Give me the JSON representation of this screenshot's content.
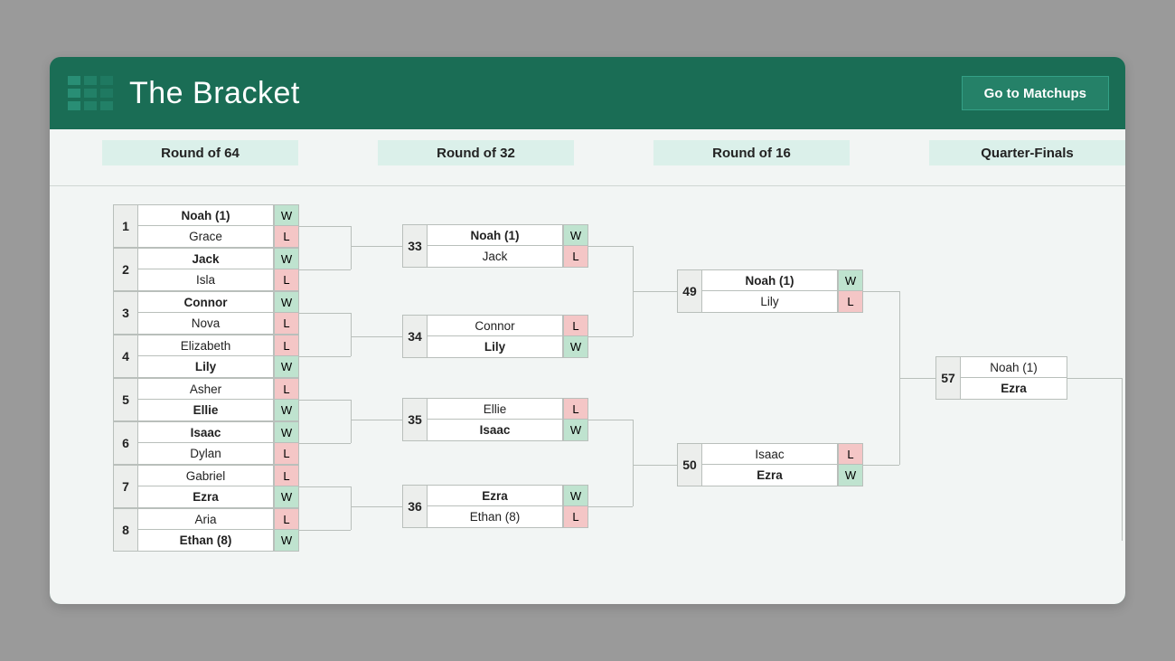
{
  "header": {
    "title": "The Bracket",
    "go_button": "Go to Matchups"
  },
  "rounds": {
    "r64": "Round of 64",
    "r32": "Round of 32",
    "r16": "Round of 16",
    "qf": "Quarter-Finals"
  },
  "bracket": {
    "r64": [
      {
        "num": "1",
        "a": {
          "name": "Noah  (1)",
          "wl": "W",
          "bold": true
        },
        "b": {
          "name": "Grace",
          "wl": "L"
        }
      },
      {
        "num": "2",
        "a": {
          "name": "Jack",
          "wl": "W",
          "bold": true
        },
        "b": {
          "name": "Isla",
          "wl": "L"
        }
      },
      {
        "num": "3",
        "a": {
          "name": "Connor",
          "wl": "W",
          "bold": true
        },
        "b": {
          "name": "Nova",
          "wl": "L"
        }
      },
      {
        "num": "4",
        "a": {
          "name": "Elizabeth",
          "wl": "L"
        },
        "b": {
          "name": "Lily",
          "wl": "W",
          "bold": true
        }
      },
      {
        "num": "5",
        "a": {
          "name": "Asher",
          "wl": "L"
        },
        "b": {
          "name": "Ellie",
          "wl": "W",
          "bold": true
        }
      },
      {
        "num": "6",
        "a": {
          "name": "Isaac",
          "wl": "W",
          "bold": true
        },
        "b": {
          "name": "Dylan",
          "wl": "L"
        }
      },
      {
        "num": "7",
        "a": {
          "name": "Gabriel",
          "wl": "L"
        },
        "b": {
          "name": "Ezra",
          "wl": "W",
          "bold": true
        }
      },
      {
        "num": "8",
        "a": {
          "name": "Aria",
          "wl": "L"
        },
        "b": {
          "name": "Ethan  (8)",
          "wl": "W",
          "bold": true
        }
      }
    ],
    "r32": [
      {
        "num": "33",
        "a": {
          "name": "Noah  (1)",
          "wl": "W",
          "bold": true
        },
        "b": {
          "name": "Jack",
          "wl": "L"
        }
      },
      {
        "num": "34",
        "a": {
          "name": "Connor",
          "wl": "L"
        },
        "b": {
          "name": "Lily",
          "wl": "W",
          "bold": true
        }
      },
      {
        "num": "35",
        "a": {
          "name": "Ellie",
          "wl": "L"
        },
        "b": {
          "name": "Isaac",
          "wl": "W",
          "bold": true
        }
      },
      {
        "num": "36",
        "a": {
          "name": "Ezra",
          "wl": "W",
          "bold": true
        },
        "b": {
          "name": "Ethan  (8)",
          "wl": "L"
        }
      }
    ],
    "r16": [
      {
        "num": "49",
        "a": {
          "name": "Noah  (1)",
          "wl": "W",
          "bold": true
        },
        "b": {
          "name": "Lily",
          "wl": "L"
        }
      },
      {
        "num": "50",
        "a": {
          "name": "Isaac",
          "wl": "L"
        },
        "b": {
          "name": "Ezra",
          "wl": "W",
          "bold": true
        }
      }
    ],
    "qf": [
      {
        "num": "57",
        "a": {
          "name": "Noah  (1)"
        },
        "b": {
          "name": "Ezra",
          "bold": true
        }
      }
    ]
  }
}
